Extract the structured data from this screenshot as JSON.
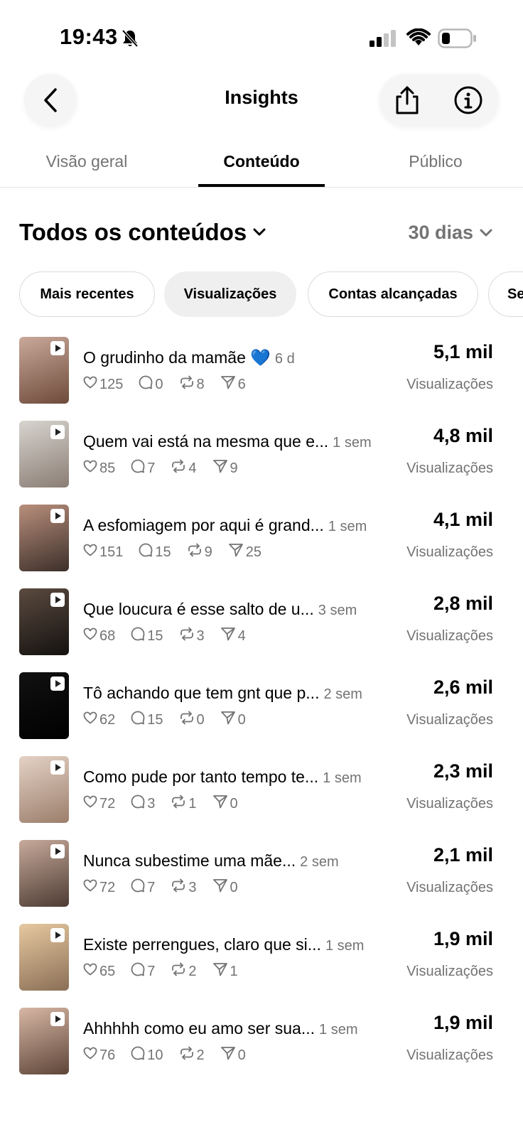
{
  "status_bar": {
    "time": "19:43"
  },
  "header": {
    "title": "Insights"
  },
  "tabs": [
    {
      "label": "Visão geral",
      "active": false
    },
    {
      "label": "Conteúdo",
      "active": true
    },
    {
      "label": "Público",
      "active": false
    }
  ],
  "filter": {
    "content_type": "Todos os conteúdos",
    "period": "30 dias"
  },
  "chips": [
    {
      "label": "Mais recentes",
      "selected": false
    },
    {
      "label": "Visualizações",
      "selected": true
    },
    {
      "label": "Contas alcançadas",
      "selected": false
    },
    {
      "label": "Se",
      "selected": false
    }
  ],
  "items": [
    {
      "caption": "O grudinho da mamãe 💙",
      "age": "6 d",
      "likes": "125",
      "comments": "0",
      "reposts": "8",
      "shares": "6",
      "value": "5,1 mil",
      "metric": "Visualizações",
      "thumb_colors": [
        "#c9a99a",
        "#6e4a3a"
      ]
    },
    {
      "caption": "Quem vai está na mesma que e...",
      "age": "1 sem",
      "likes": "85",
      "comments": "7",
      "reposts": "4",
      "shares": "9",
      "value": "4,8 mil",
      "metric": "Visualizações",
      "thumb_colors": [
        "#d8d4cf",
        "#8a7d74"
      ]
    },
    {
      "caption": "A esfomiagem por aqui é grand...",
      "age": "1 sem",
      "likes": "151",
      "comments": "15",
      "reposts": "9",
      "shares": "25",
      "value": "4,1 mil",
      "metric": "Visualizações",
      "thumb_colors": [
        "#b98f7c",
        "#3c2f2a"
      ]
    },
    {
      "caption": "Que loucura é esse salto de u...",
      "age": "3 sem",
      "likes": "68",
      "comments": "15",
      "reposts": "3",
      "shares": "4",
      "value": "2,8 mil",
      "metric": "Visualizações",
      "thumb_colors": [
        "#5b4a3f",
        "#141210"
      ]
    },
    {
      "caption": "Tô achando que tem gnt que p...",
      "age": "2 sem",
      "likes": "62",
      "comments": "15",
      "reposts": "0",
      "shares": "0",
      "value": "2,6 mil",
      "metric": "Visualizações",
      "thumb_colors": [
        "#111111",
        "#000000"
      ]
    },
    {
      "caption": "Como pude por tanto tempo te...",
      "age": "1 sem",
      "likes": "72",
      "comments": "3",
      "reposts": "1",
      "shares": "0",
      "value": "2,3 mil",
      "metric": "Visualizações",
      "thumb_colors": [
        "#e4d2c6",
        "#9c7e6b"
      ]
    },
    {
      "caption": "Nunca subestime uma mãe...",
      "age": "2 sem",
      "likes": "72",
      "comments": "7",
      "reposts": "3",
      "shares": "0",
      "value": "2,1 mil",
      "metric": "Visualizações",
      "thumb_colors": [
        "#c7aa9b",
        "#4d3b33"
      ]
    },
    {
      "caption": "Existe perrengues, claro que si...",
      "age": "1 sem",
      "likes": "65",
      "comments": "7",
      "reposts": "2",
      "shares": "1",
      "value": "1,9 mil",
      "metric": "Visualizações",
      "thumb_colors": [
        "#e6c9a0",
        "#8b6f56"
      ]
    },
    {
      "caption": "Ahhhhh como eu amo ser sua...",
      "age": "1 sem",
      "likes": "76",
      "comments": "10",
      "reposts": "2",
      "shares": "0",
      "value": "1,9 mil",
      "metric": "Visualizações",
      "thumb_colors": [
        "#d7b7a5",
        "#5e4538"
      ]
    }
  ]
}
